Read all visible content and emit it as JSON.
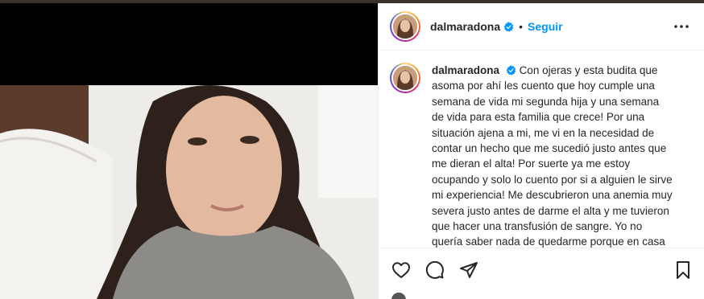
{
  "post": {
    "username": "dalmaradona",
    "follow_label": "Seguir",
    "separator": "•",
    "caption": "Con ojeras y esta budita que asoma por ahí les cuento que hoy cumple una semana de vida mi segunda hija y una semana de vida para esta familia que crece! Por una situación ajena a mi, me vi en la necesidad de contar un hecho que me sucedió justo antes que me dieran el alta! Por suerte ya me estoy ocupando y solo lo cuento por si a alguien le sirve mi experiencia! Me descubrieron una anemia muy severa justo antes de darme el alta y me tuvieron que hacer una transfusión de sangre. Yo no quería saber nada de quedarme porque en casa me esperaba Roma, pero obviamente no fue opcional (porque"
  },
  "icons": {
    "verified": "verified-badge-icon",
    "more": "more-options-icon",
    "like": "heart-icon",
    "comment": "comment-icon",
    "share": "paper-plane-icon",
    "save": "bookmark-icon"
  },
  "colors": {
    "link_blue": "#0095f6",
    "text": "#262626",
    "border": "#efefef"
  }
}
